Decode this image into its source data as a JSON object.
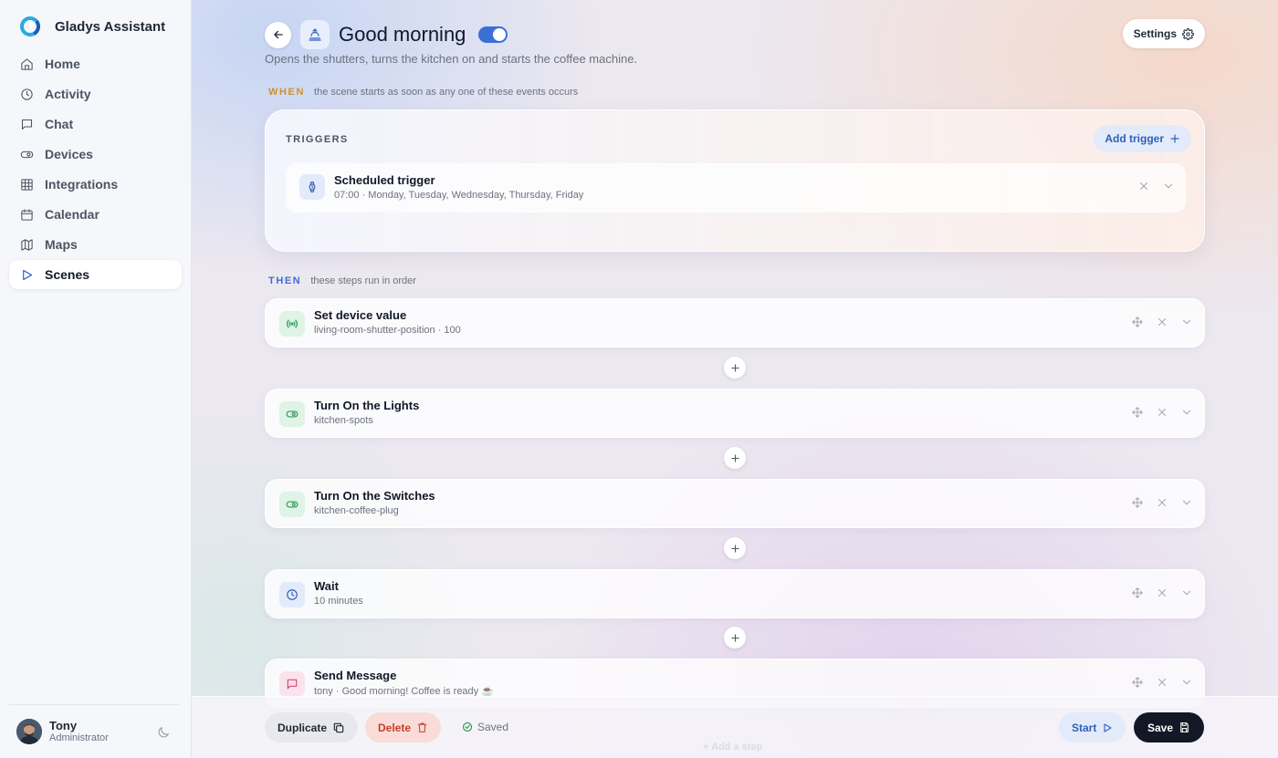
{
  "app": {
    "title": "Gladys Assistant"
  },
  "sidebar": {
    "items": [
      {
        "label": "Home",
        "icon": "home-icon",
        "active": false
      },
      {
        "label": "Activity",
        "icon": "clock-icon",
        "active": false
      },
      {
        "label": "Chat",
        "icon": "chat-icon",
        "active": false
      },
      {
        "label": "Devices",
        "icon": "toggle-icon",
        "active": false
      },
      {
        "label": "Integrations",
        "icon": "grid-icon",
        "active": false
      },
      {
        "label": "Calendar",
        "icon": "calendar-icon",
        "active": false
      },
      {
        "label": "Maps",
        "icon": "map-icon",
        "active": false
      },
      {
        "label": "Scenes",
        "icon": "play-icon",
        "active": true
      }
    ],
    "user": {
      "name": "Tony",
      "role": "Administrator"
    }
  },
  "header": {
    "title": "Good morning",
    "description": "Opens the shutters, turns the kitchen on and starts the coffee machine.",
    "enabled": true,
    "settings_label": "Settings"
  },
  "when": {
    "key": "WHEN",
    "text": "the scene starts as soon as any one of these events occurs",
    "color": "#d4902a"
  },
  "triggers": {
    "title": "TRIGGERS",
    "add_label": "Add trigger",
    "items": [
      {
        "title": "Scheduled trigger",
        "subtitle": "07:00 · Monday, Tuesday, Wednesday, Thursday, Friday",
        "icon": "watch-icon"
      }
    ]
  },
  "then": {
    "key": "THEN",
    "text": "these steps run in order",
    "color": "#3b6fd4"
  },
  "steps": [
    {
      "title": "Set device value",
      "subtitle": "living-room-shutter-position · 100",
      "icon": "broadcast-icon",
      "icon_bg": "#dff3e6",
      "icon_color": "#2e9a58"
    },
    {
      "title": "Turn On the Lights",
      "subtitle": "kitchen-spots",
      "icon": "toggle-icon",
      "icon_bg": "#dff3e6",
      "icon_color": "#2e9a58"
    },
    {
      "title": "Turn On the Switches",
      "subtitle": "kitchen-coffee-plug",
      "icon": "toggle-icon",
      "icon_bg": "#dff3e6",
      "icon_color": "#2e9a58"
    },
    {
      "title": "Wait",
      "subtitle": "10 minutes",
      "icon": "clock-icon",
      "icon_bg": "#e3ebfb",
      "icon_color": "#2f5fb8"
    },
    {
      "title": "Send Message",
      "subtitle": "tony · Good morning! Coffee is ready ☕",
      "icon": "message-icon",
      "icon_bg": "#fbe3ec",
      "icon_color": "#d44a7a"
    }
  ],
  "footer": {
    "duplicate_label": "Duplicate",
    "delete_label": "Delete",
    "saved_label": "Saved",
    "start_label": "Start",
    "save_label": "Save",
    "add_step_label": "+ Add a step"
  }
}
